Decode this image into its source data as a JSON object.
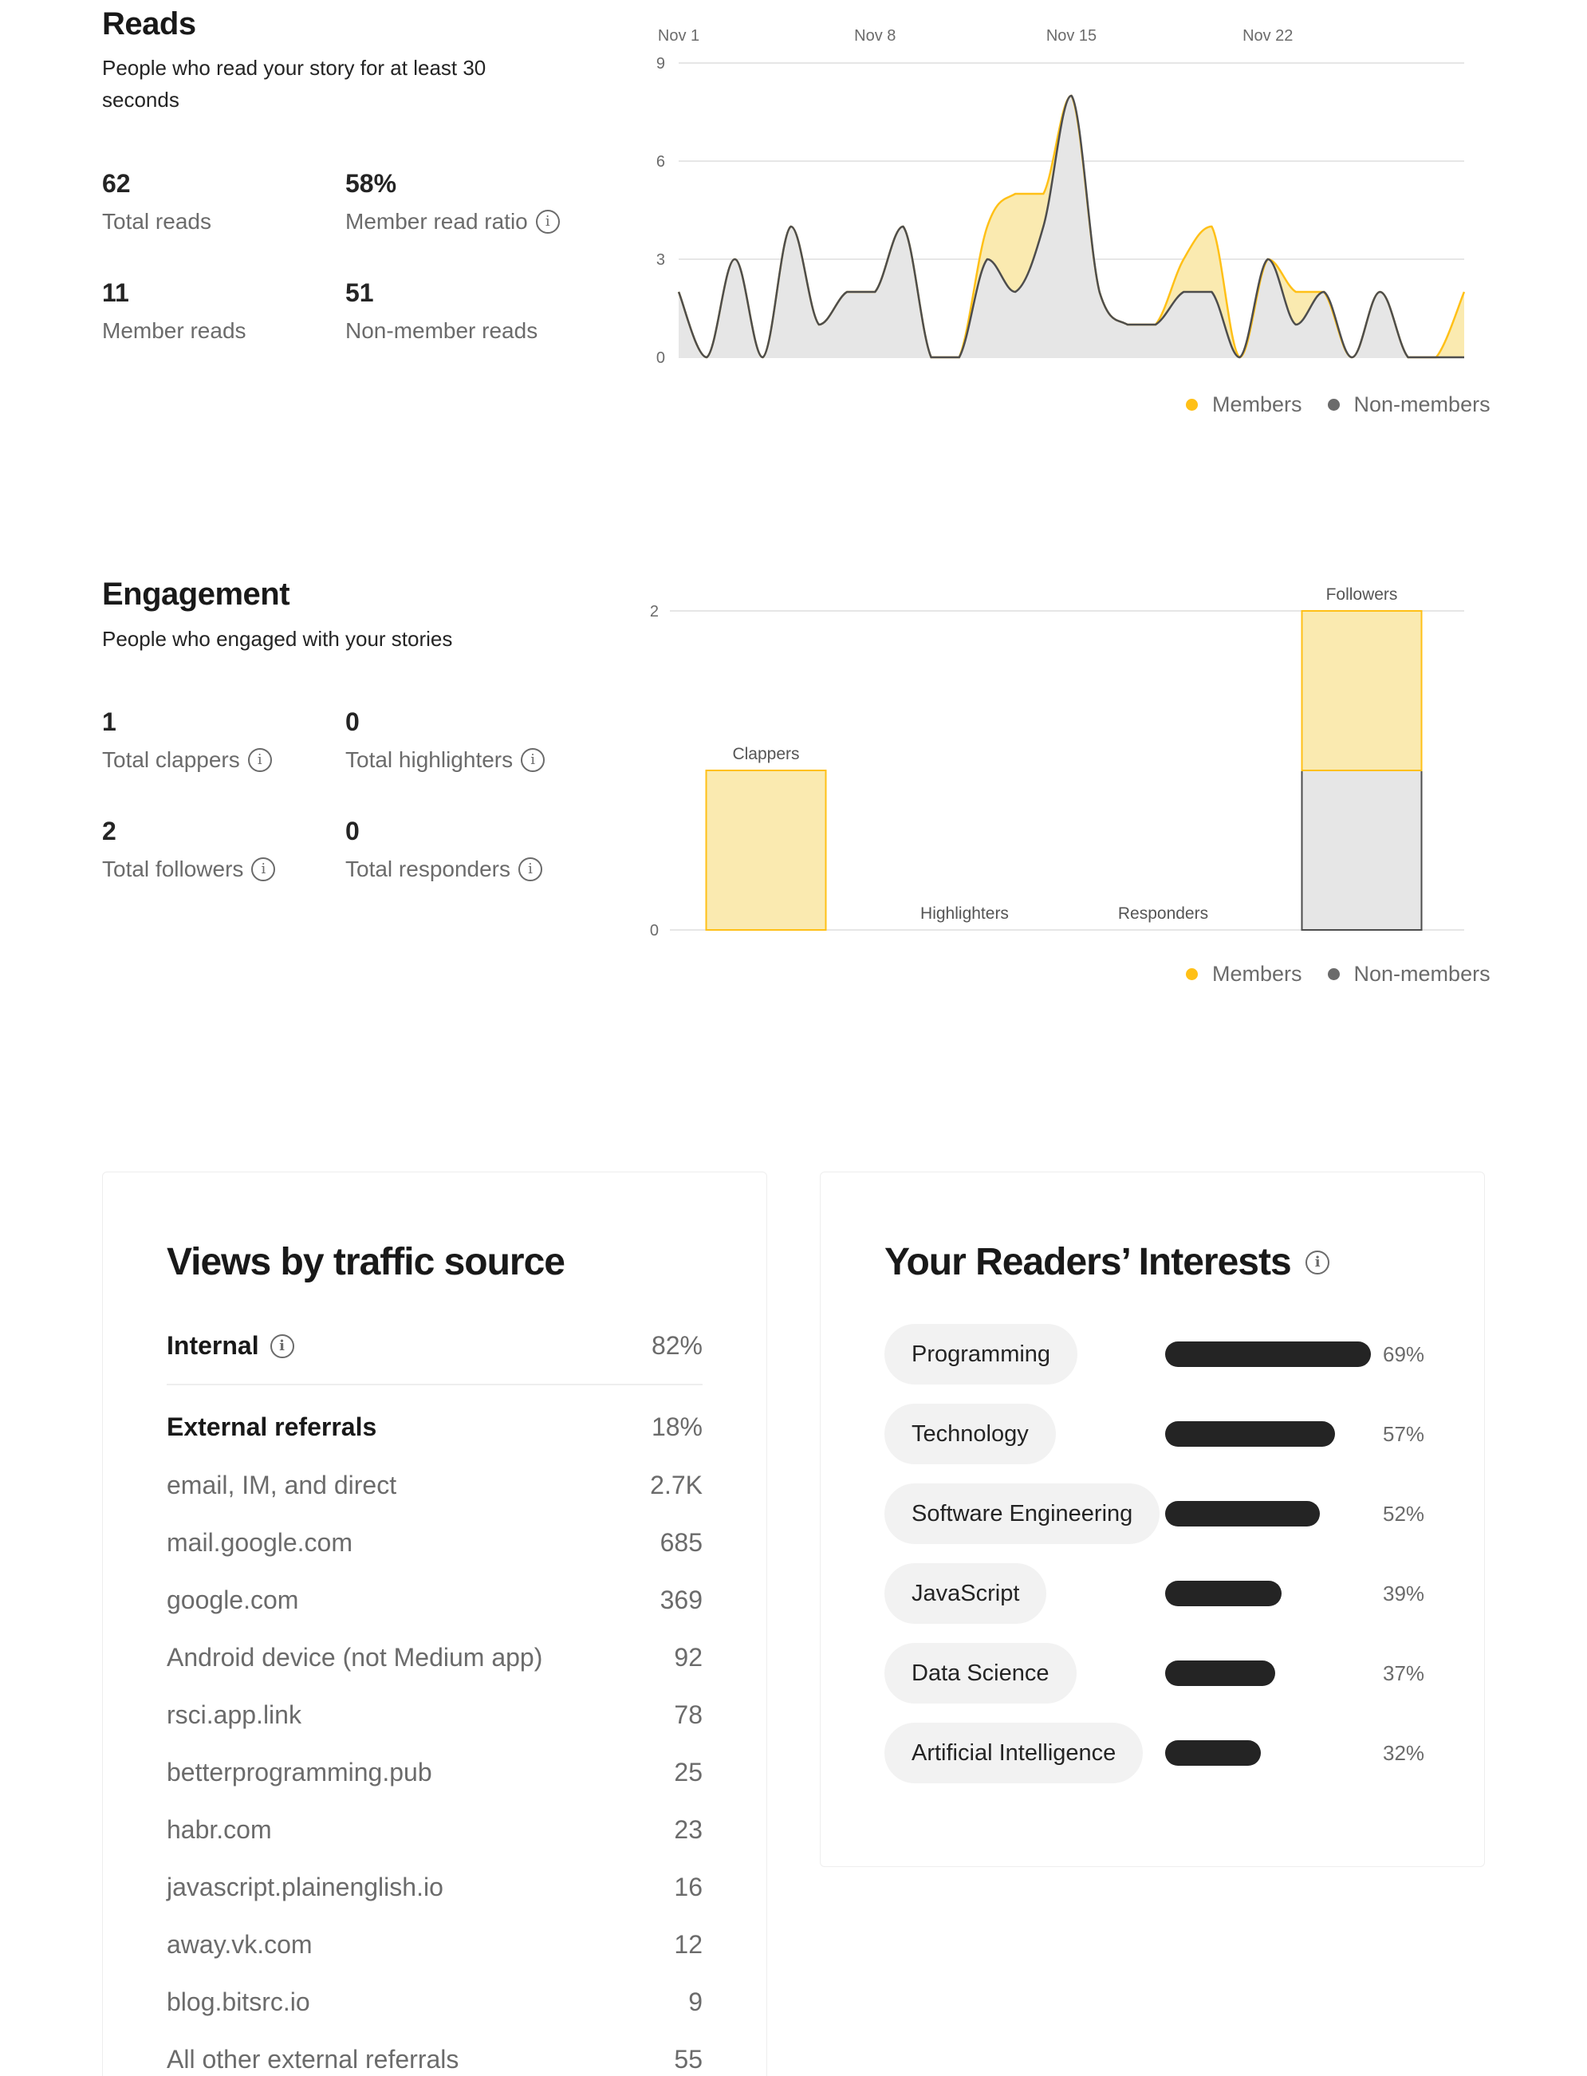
{
  "reads": {
    "title": "Reads",
    "subtitle_line1": "People who read your story for at least 30",
    "subtitle_line2": "seconds",
    "stats": [
      {
        "value": "62",
        "label": "Total reads"
      },
      {
        "value": "58%",
        "label": "Member read ratio"
      },
      {
        "value": "11",
        "label": "Member reads"
      },
      {
        "value": "51",
        "label": "Non-member reads"
      }
    ],
    "legend": {
      "members": "Members",
      "non_members": "Non-members"
    }
  },
  "engagement": {
    "title": "Engagement",
    "subtitle": "People who engaged with your stories",
    "stats": [
      {
        "value": "1",
        "label": "Total clappers"
      },
      {
        "value": "0",
        "label": "Total highlighters"
      },
      {
        "value": "2",
        "label": "Total followers"
      },
      {
        "value": "0",
        "label": "Total responders"
      }
    ],
    "legend": {
      "members": "Members",
      "non_members": "Non-members"
    }
  },
  "colors": {
    "members": "#ffc017",
    "members_fill": "#faeab0",
    "non_members": "#6b6b6b",
    "non_members_fill": "#e6e6e6",
    "line": "#4d4d4d"
  },
  "chart_data": [
    {
      "type": "area",
      "x_tick_labels": [
        "Nov 1",
        "Nov 8",
        "Nov 15",
        "Nov 22"
      ],
      "x_days": [
        1,
        2,
        3,
        4,
        5,
        6,
        7,
        8,
        9,
        10,
        11,
        12,
        13,
        14,
        15,
        16,
        17,
        18,
        19,
        20,
        21,
        22,
        23,
        24,
        25,
        26,
        27,
        28,
        29
      ],
      "ylim": [
        0,
        9
      ],
      "y_ticks": [
        0,
        3,
        6,
        9
      ],
      "grid": true,
      "legend_position": "bottom-right",
      "series": [
        {
          "name": "Members",
          "values": [
            2,
            0,
            3,
            0,
            4,
            1,
            2,
            2,
            4,
            0,
            0,
            4,
            5,
            5,
            8,
            2,
            1,
            1,
            3,
            4,
            0,
            3,
            2,
            2,
            0,
            2,
            0,
            0,
            2
          ]
        },
        {
          "name": "Non-members",
          "values": [
            2,
            0,
            3,
            0,
            4,
            1,
            2,
            2,
            4,
            0,
            0,
            3,
            2,
            4,
            8,
            2,
            1,
            1,
            2,
            2,
            0,
            3,
            1,
            2,
            0,
            2,
            0,
            0,
            0
          ]
        }
      ]
    },
    {
      "type": "bar",
      "categories": [
        "Clappers",
        "Highlighters",
        "Responders",
        "Followers"
      ],
      "ylim": [
        0,
        2
      ],
      "y_ticks": [
        0,
        2
      ],
      "grid": true,
      "legend_position": "bottom-right",
      "series": [
        {
          "name": "Members",
          "values": [
            1,
            0,
            0,
            1
          ]
        },
        {
          "name": "Non-members",
          "values": [
            0,
            0,
            0,
            1
          ]
        }
      ]
    }
  ],
  "traffic": {
    "title": "Views by traffic source",
    "internal": {
      "label": "Internal",
      "value": "82%"
    },
    "external": {
      "label": "External referrals",
      "value": "18%"
    },
    "rows": [
      {
        "label": "email, IM, and direct",
        "value": "2.7K"
      },
      {
        "label": "mail.google.com",
        "value": "685"
      },
      {
        "label": "google.com",
        "value": "369"
      },
      {
        "label": "Android device (not Medium app)",
        "value": "92"
      },
      {
        "label": "rsci.app.link",
        "value": "78"
      },
      {
        "label": "betterprogramming.pub",
        "value": "25"
      },
      {
        "label": "habr.com",
        "value": "23"
      },
      {
        "label": "javascript.plainenglish.io",
        "value": "16"
      },
      {
        "label": "away.vk.com",
        "value": "12"
      },
      {
        "label": "blog.bitsrc.io",
        "value": "9"
      },
      {
        "label": "All other external referrals",
        "value": "55"
      }
    ]
  },
  "interests": {
    "title": "Your Readers’ Interests",
    "items": [
      {
        "label": "Programming",
        "pct": "69%",
        "share": 0.69
      },
      {
        "label": "Technology",
        "pct": "57%",
        "share": 0.57
      },
      {
        "label": "Software Engineering",
        "pct": "52%",
        "share": 0.52
      },
      {
        "label": "JavaScript",
        "pct": "39%",
        "share": 0.39
      },
      {
        "label": "Data Science",
        "pct": "37%",
        "share": 0.37
      },
      {
        "label": "Artificial Intelligence",
        "pct": "32%",
        "share": 0.32
      }
    ]
  }
}
